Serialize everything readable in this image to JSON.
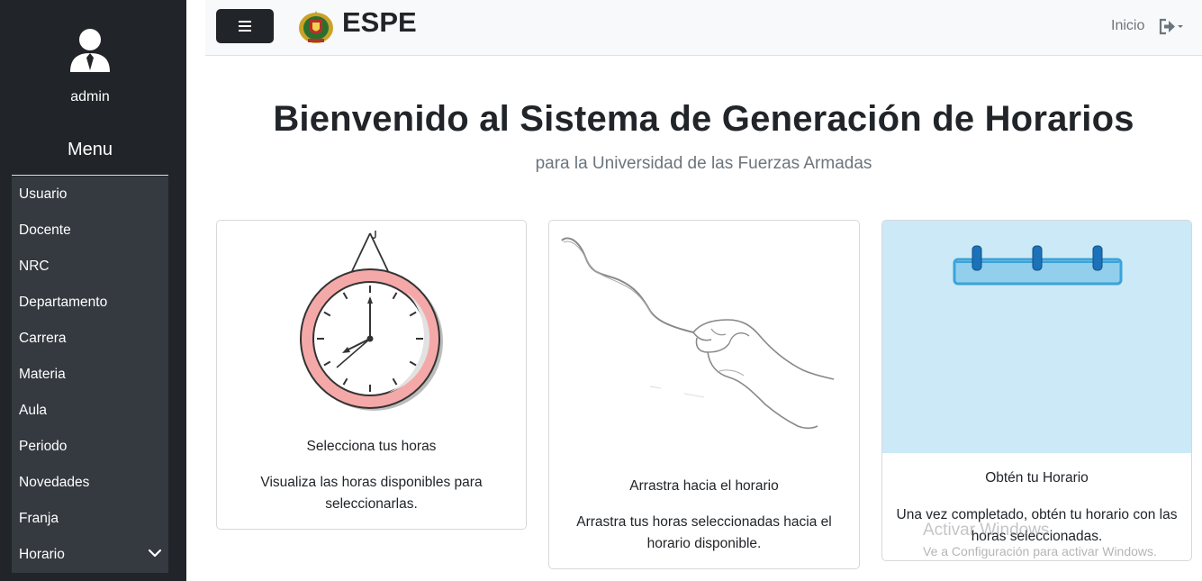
{
  "sidebar": {
    "username": "admin",
    "menu_title": "Menu",
    "items": [
      {
        "label": "Usuario"
      },
      {
        "label": "Docente"
      },
      {
        "label": "NRC"
      },
      {
        "label": "Departamento"
      },
      {
        "label": "Carrera"
      },
      {
        "label": "Materia"
      },
      {
        "label": "Aula"
      },
      {
        "label": "Periodo"
      },
      {
        "label": "Novedades"
      },
      {
        "label": "Franja"
      },
      {
        "label": "Horario"
      }
    ]
  },
  "navbar": {
    "brand": "ESPE",
    "inicio": "Inicio",
    "toggle_icon": "hamburger-icon",
    "logout_icon": "sign-out-icon"
  },
  "main": {
    "title": "Bienvenido al Sistema de Generación de Horarios",
    "subtitle": "para la Universidad de las Fuerzas Armadas",
    "cards": [
      {
        "title": "Selecciona tus horas",
        "text": "Visualiza las horas disponibles para seleccionarlas.",
        "image": "clock-illustration"
      },
      {
        "title": "Arrastra hacia el horario",
        "text": "Arrastra tus horas seleccionadas hacia el horario disponible.",
        "image": "hand-drag-illustration"
      },
      {
        "title": "Obtén tu Horario",
        "text": "Una vez completado, obtén tu horario con las horas seleccionadas.",
        "image": "calendar-binder-illustration"
      }
    ]
  },
  "watermark": {
    "title": "Activar Windows",
    "subtitle": "Ve a Configuración para activar Windows."
  },
  "colors": {
    "sidebar_bg": "#212529",
    "menu_bg": "#343a40",
    "navbar_bg": "#f8f9fa",
    "calendar_bg": "#cbe9f6",
    "clock_rim": "#f4a9a8"
  }
}
